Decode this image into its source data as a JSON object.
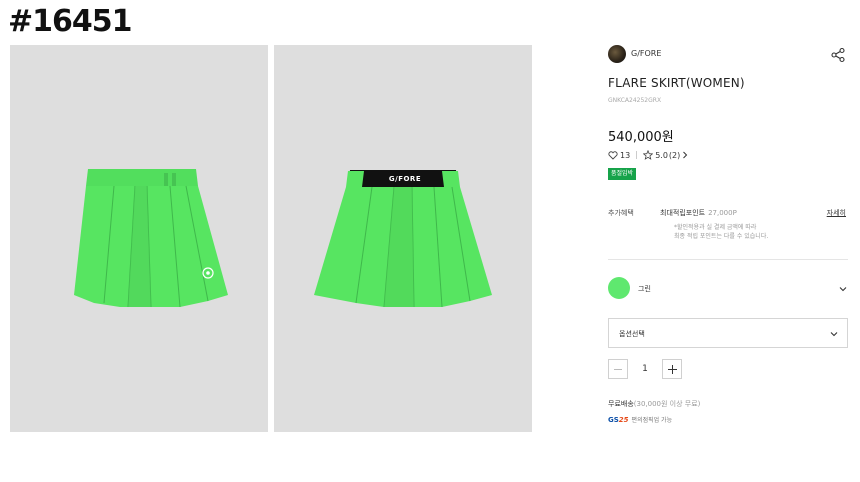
{
  "tag_id": "#16451",
  "product": {
    "brand": "G/FORE",
    "title": "FLARE SKIRT(WOMEN)",
    "code": "GNKCA24252GRX",
    "price": "540,000원",
    "likes": "13",
    "rating": "5.0",
    "review_count": "(2)",
    "badge": "품절임박",
    "logo_text": "G/FORE"
  },
  "benefit": {
    "label": "추가혜택",
    "point_label": "최대적립포인트",
    "point_amount": "27,000P",
    "detail_link": "자세히",
    "note_line1": "*할인적용과 실 결제 금액에 따라",
    "note_line2": "최종 적립 포인트는 다를 수 있습니다."
  },
  "color": {
    "name": "그린",
    "hex": "#5fe86f"
  },
  "option": {
    "placeholder": "옵션선택"
  },
  "quantity": {
    "value": "1"
  },
  "shipping": {
    "free_label": "무료배송",
    "condition": "(30,000원 이상 무료)"
  },
  "gs25": {
    "logo_gs": "GS",
    "logo_num": "25",
    "text": "편의점픽업 가능"
  },
  "colors": {
    "skirt_green": "#55e35f",
    "badge_green": "#16a34a"
  }
}
